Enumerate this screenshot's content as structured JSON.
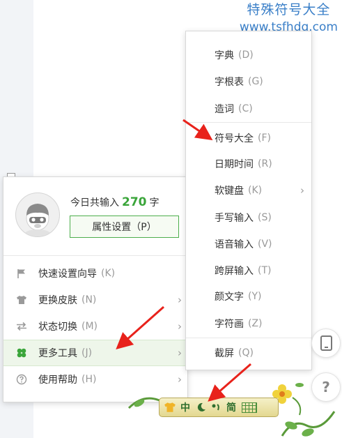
{
  "watermark": {
    "title": "特殊符号大全",
    "url": "www.tsfhdq.com"
  },
  "main_menu": {
    "input_prefix": "今日共输入",
    "input_count": "270",
    "input_suffix": "字",
    "attr_button": "属性设置（P）",
    "items": [
      {
        "label": "快速设置向导",
        "shortcut": "(K)",
        "icon": "flag-icon",
        "has_submenu": false
      },
      {
        "label": "更换皮肤",
        "shortcut": "(N)",
        "icon": "tshirt-icon",
        "has_submenu": true
      },
      {
        "label": "状态切换",
        "shortcut": "(M)",
        "icon": "switch-arrows-icon",
        "has_submenu": true
      },
      {
        "label": "更多工具",
        "shortcut": "(J)",
        "icon": "clover-icon",
        "has_submenu": true,
        "highlighted": true
      },
      {
        "label": "使用帮助",
        "shortcut": "(H)",
        "icon": "help-circle-icon",
        "has_submenu": true
      }
    ]
  },
  "sub_menu": {
    "items": [
      {
        "label": "字典",
        "shortcut": "(D)"
      },
      {
        "label": "字根表",
        "shortcut": "(G)"
      },
      {
        "label": "造词",
        "shortcut": "(C)"
      },
      {
        "label": "符号大全",
        "shortcut": "(F)"
      },
      {
        "label": "日期时间",
        "shortcut": "(R)"
      },
      {
        "label": "软键盘",
        "shortcut": "(K)",
        "has_submenu": true
      },
      {
        "label": "手写输入",
        "shortcut": "(S)"
      },
      {
        "label": "语音输入",
        "shortcut": "(V)"
      },
      {
        "label": "跨屏输入",
        "shortcut": "(T)"
      },
      {
        "label": "颜文字",
        "shortcut": "(Y)"
      },
      {
        "label": "字符画",
        "shortcut": "(Z)"
      },
      {
        "label": "截屏",
        "shortcut": "(Q)"
      }
    ]
  },
  "ime_bar": {
    "mode_chinese": "中",
    "mode_simplified": "简"
  },
  "side_buttons": {
    "help_symbol": "?"
  },
  "colors": {
    "accent_green": "#3aa53a",
    "annotation_red": "#e8221b",
    "watermark_blue": "#3a7fc8"
  }
}
